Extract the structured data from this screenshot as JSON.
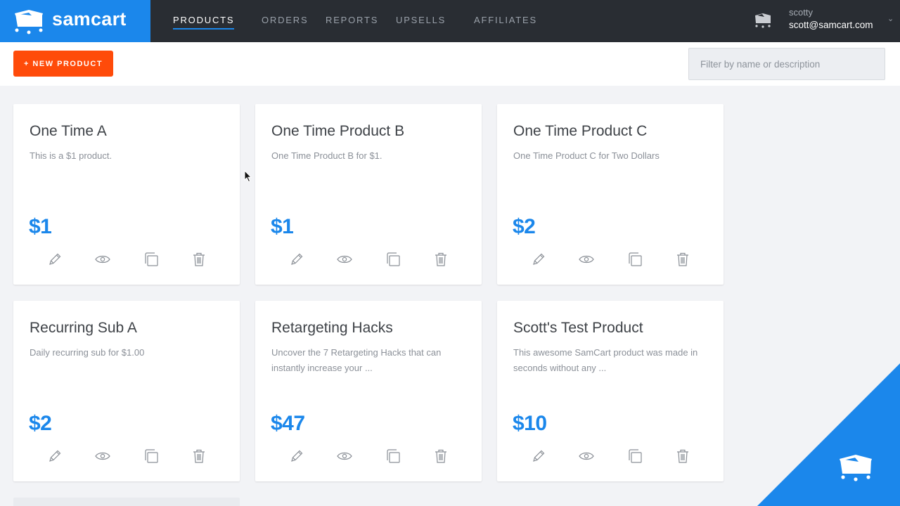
{
  "brand": {
    "name": "samcart",
    "color": "#1b87eb"
  },
  "nav": {
    "items": [
      {
        "label": "PRODUCTS",
        "active": true
      },
      {
        "label": "ORDERS",
        "active": false
      },
      {
        "label": "REPORTS",
        "active": false
      },
      {
        "label": "UPSELLS",
        "active": false
      },
      {
        "label": "AFFILIATES",
        "active": false
      }
    ]
  },
  "user": {
    "name": "scotty",
    "email": "scott@samcart.com",
    "menu_icon": "chevron-down-icon"
  },
  "toolbar": {
    "new_product_label": "+ NEW PRODUCT",
    "new_product_color": "#ff4b0a",
    "filter_placeholder": "Filter by name or description",
    "filter_value": ""
  },
  "products": [
    {
      "title": "One Time A",
      "description": "This is a $1 product.",
      "price": "$1"
    },
    {
      "title": "One Time Product B",
      "description": "One Time Product B for $1.",
      "price": "$1"
    },
    {
      "title": "One Time Product C",
      "description": "One Time Product C for Two Dollars",
      "price": "$2"
    },
    {
      "title": "Recurring Sub A",
      "description": "Daily recurring sub for $1.00",
      "price": "$2"
    },
    {
      "title": "Retargeting Hacks",
      "description": "Uncover the 7 Retargeting Hacks that can instantly increase your ...",
      "price": "$47"
    },
    {
      "title": "Scott's Test Product",
      "description": "This awesome SamCart product was made in seconds without any ...",
      "price": "$10"
    }
  ],
  "card_actions": [
    "edit-icon",
    "preview-icon",
    "duplicate-icon",
    "delete-icon"
  ]
}
